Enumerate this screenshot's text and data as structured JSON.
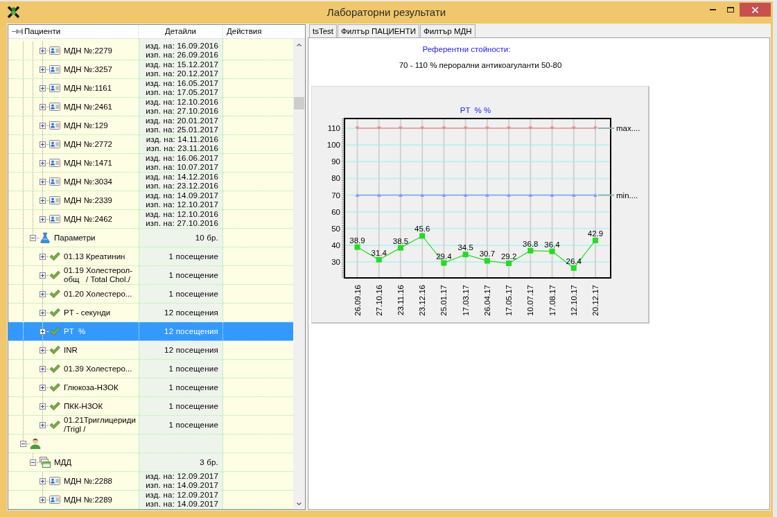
{
  "window": {
    "title": "Лабораторни результати"
  },
  "tree": {
    "columns": [
      "Пациенти",
      "Детайли",
      "Действия"
    ],
    "nodes": [
      {
        "children": [
          {
            "children": [
              {
                "kind": "mdn",
                "label": "МДН №:2279",
                "issued": "изд. на: 16.09.2016",
                "executed": "изп. на: 26.09.2016",
                "expanded": false,
                "selected": false
              },
              {
                "kind": "mdn",
                "label": "МДН №:3257",
                "issued": "изд. на: 15.12.2017",
                "executed": "изп. на: 20.12.2017",
                "expanded": false,
                "selected": false
              },
              {
                "kind": "mdn",
                "label": "МДН №:1161",
                "issued": "изд. на: 16.05.2017",
                "executed": "изп. на: 17.05.2017",
                "expanded": false,
                "selected": false
              },
              {
                "kind": "mdn",
                "label": "МДН №:2461",
                "issued": "изд. на: 12.10.2016",
                "executed": "изп. на: 27.10.2016",
                "expanded": false,
                "selected": false
              },
              {
                "kind": "mdn",
                "label": "МДН №:129",
                "issued": "изд. на: 20.01.2017",
                "executed": "изп. на: 25.01.2017",
                "expanded": false,
                "selected": false
              },
              {
                "kind": "mdn",
                "label": "МДН №:2772",
                "issued": "изд. на: 14.11.2016",
                "executed": "изп. на: 23.11.2016",
                "expanded": false,
                "selected": false
              },
              {
                "kind": "mdn",
                "label": "МДН №:1471",
                "issued": "изд. на: 16.06.2017",
                "executed": "изп. на: 10.07.2017",
                "expanded": false,
                "selected": false
              },
              {
                "kind": "mdn",
                "label": "МДН №:3034",
                "issued": "изд. на: 14.12.2016",
                "executed": "изп. на: 23.12.2016",
                "expanded": false,
                "selected": false
              },
              {
                "kind": "mdn",
                "label": "МДН №:2339",
                "issued": "изд. на: 14.09.2017",
                "executed": "изп. на: 12.10.2017",
                "expanded": false,
                "selected": false
              },
              {
                "kind": "mdn",
                "label": "МДН №:2462",
                "issued": "изд. на: 12.10.2016",
                "executed": "изп. на: 27.10.2016",
                "expanded": false,
                "selected": false
              }
            ]
          },
          {
            "kind": "parameters",
            "label": "Параметри",
            "details": "10 бр.",
            "expanded": true,
            "selected": false,
            "children": [
              {
                "kind": "parameter",
                "label": "01.13 Креатинин",
                "details": "1 посещение",
                "expanded": false,
                "selected": false
              },
              {
                "kind": "parameter",
                "label": "01.19 Холестерол-общ   / Total Chol./",
                "details": "1 посещение",
                "expanded": false,
                "selected": false
              },
              {
                "kind": "parameter",
                "label": "01.20 Холестеро...",
                "details": "1 посещение",
                "expanded": false,
                "selected": false
              },
              {
                "kind": "parameter",
                "label": "PT - секунди",
                "details": "12 посещения",
                "expanded": false,
                "selected": false
              },
              {
                "kind": "parameter",
                "label": "PT  %",
                "details": "12 посещения",
                "expanded": false,
                "selected": true
              },
              {
                "kind": "parameter",
                "label": "INR",
                "details": "12 посещения",
                "expanded": false,
                "selected": false
              },
              {
                "kind": "parameter",
                "label": "01.39 Холестеро...",
                "details": "1 посещение",
                "expanded": false,
                "selected": false
              },
              {
                "kind": "parameter",
                "label": "Глюкоза-НЗОК",
                "details": "1 посещение",
                "expanded": false,
                "selected": false
              },
              {
                "kind": "parameter",
                "label": "ПКК-НЗОК",
                "details": "1 посещение",
                "expanded": false,
                "selected": false
              },
              {
                "kind": "parameter",
                "label": "01.21Триглицериди   /Trigl /",
                "details": "1 посещение",
                "expanded": false,
                "selected": false
              }
            ]
          }
        ]
      },
      {
        "kind": "patient",
        "expanded": true,
        "selected": false,
        "children": [
          {
            "kind": "mdd",
            "label": "МДД",
            "details": "3 бр.",
            "expanded": true,
            "selected": false,
            "children": [
              {
                "kind": "mdn",
                "label": "МДН №:2288",
                "issued": "изд. на: 12.09.2017",
                "executed": "изп. на: 14.09.2017",
                "expanded": false,
                "selected": false
              },
              {
                "kind": "mdn",
                "label": "МДН №:2289",
                "issued": "изд. на: 12.09.2017",
                "executed": "изп. на: 14.09.2017",
                "expanded": false,
                "selected": false
              }
            ]
          }
        ]
      }
    ]
  },
  "tabs": [
    {
      "label": "tsTest"
    },
    {
      "label": "Филтър ПАЦИЕНТИ"
    },
    {
      "label": "Филтър МДН"
    }
  ],
  "reference": {
    "title": "Референтни стойности:",
    "text": "70 - 110 % перорални антикоагуланти 50-80"
  },
  "chart_data": {
    "type": "line",
    "title": "PT  % %",
    "grid": true,
    "categories": [
      "26.09.16",
      "27.10.16",
      "23.11.16",
      "23.12.16",
      "25.01.17",
      "17.03.17",
      "26.04.17",
      "17.05.17",
      "10.07.17",
      "17.08.17",
      "12.10.17",
      "20.12.17"
    ],
    "ylim": [
      20.5,
      115.8
    ],
    "yticks": [
      30,
      40,
      50,
      60,
      70,
      80,
      90,
      100,
      110
    ],
    "series": [
      {
        "color": "#22dd22",
        "marker": "square",
        "data_labels": true,
        "values": [
          38.9,
          31.4,
          38.5,
          45.6,
          29.4,
          34.5,
          30.7,
          29.2,
          36.8,
          36.4,
          26.4,
          42.9
        ]
      },
      {
        "name": "max....",
        "color": "#f08c8c",
        "marker": "triangle-down",
        "values": [
          110,
          110,
          110,
          110,
          110,
          110,
          110,
          110,
          110,
          110,
          110,
          110
        ]
      },
      {
        "name": "min....",
        "color": "#7f9ff0",
        "marker": "triangle-up",
        "values": [
          70,
          70,
          70,
          70,
          70,
          70,
          70,
          70,
          70,
          70,
          70,
          70
        ]
      }
    ]
  }
}
